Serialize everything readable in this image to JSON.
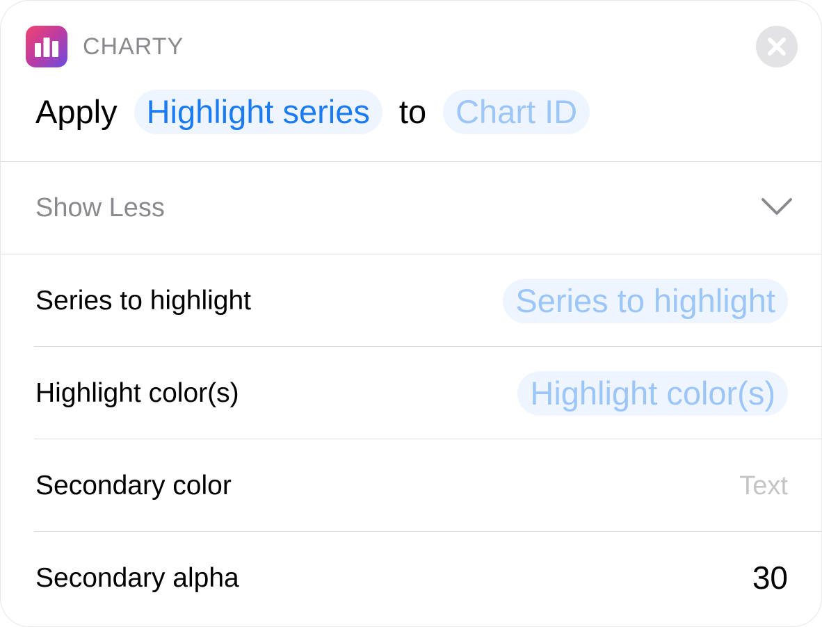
{
  "app": {
    "name": "CHARTY",
    "icon": "bar-chart-icon",
    "icon_gradient": [
      "#f0456f",
      "#c23c9d",
      "#6a4be0"
    ]
  },
  "action": {
    "verb": "Apply",
    "operation": "Highlight series",
    "connector": "to",
    "target_placeholder": "Chart ID"
  },
  "toggle": {
    "label": "Show Less",
    "icon": "chevron-down-icon"
  },
  "params": [
    {
      "label": "Series to highlight",
      "placeholder": "Series to highlight"
    },
    {
      "label": "Highlight color(s)",
      "placeholder": "Highlight color(s)"
    },
    {
      "label": "Secondary color",
      "placeholder": "Text"
    },
    {
      "label": "Secondary alpha",
      "value": "30"
    }
  ],
  "colors": {
    "accent": "#1a7bf2",
    "token_background": "#eef5fe",
    "placeholder_blue": "#9cc6f7",
    "secondary_text": "#8a8a8e"
  }
}
